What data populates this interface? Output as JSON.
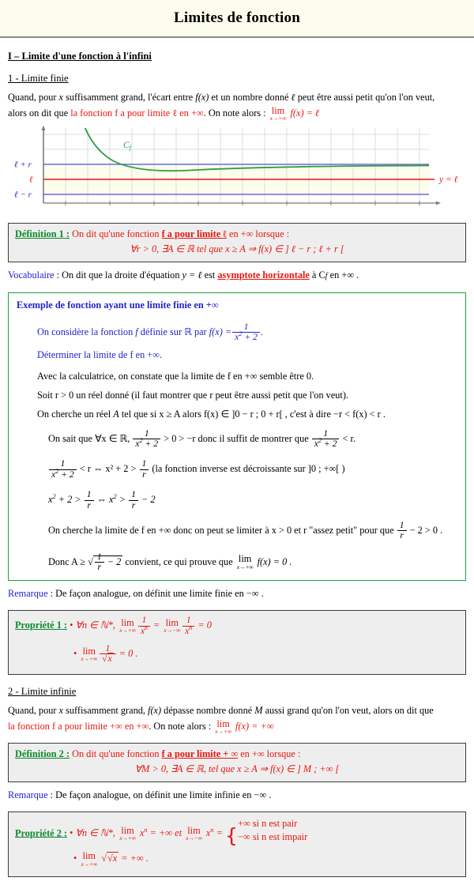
{
  "header": {
    "title": "Limites de fonction"
  },
  "section1": {
    "heading": "I – Limite d'une fonction à l'infini",
    "sub1": "1 - Limite finie",
    "intro_a": "Quand, pour ",
    "intro_x": "x",
    "intro_b": " suffisamment grand, l'écart entre ",
    "intro_fx": "f(x)",
    "intro_c": " et un nombre donné ",
    "intro_l": "ℓ",
    "intro_d": " peut être aussi petit qu'on l'on veut,",
    "intro_e": "alors on dit que ",
    "intro_red": "la fonction f a pour limite ℓ en +∞",
    "intro_f": ". On note alors : ",
    "lim_label": "lim",
    "lim_sub": "x→+∞",
    "lim_body": "f(x) = ℓ"
  },
  "graph": {
    "label_curve": "Cf",
    "label_upper": "ℓ + r",
    "label_mid": "ℓ",
    "label_lower": "ℓ − r",
    "label_asymptote": "y = ℓ",
    "colors": {
      "curve": "#2e9e3e",
      "band": "#6a6ae0",
      "mid": "#e8150f",
      "axis": "#7b7b7b",
      "grid": "#d8d8d8",
      "fill": "#fdfdee"
    }
  },
  "definition1": {
    "label": "Définition 1 :",
    "text_a": "On dit qu'une fonction ",
    "text_bold": "f a pour limite ℓ",
    "text_b": " en +∞ lorsque :",
    "formula": "∀r > 0,  ∃A ∈ ℝ tel que  x ≥ A  ⇒  f(x) ∈ ] ℓ − r ; ℓ + r ["
  },
  "vocabulaire": {
    "label": "Vocabulaire",
    "text_a": " : On dit que la droite d'équation  ",
    "eq": "y = ℓ",
    "text_b": "  est ",
    "underlined": "asymptote horizontale",
    "text_c": " à C",
    "sub": "f",
    "text_d": " en +∞ ."
  },
  "example": {
    "title": "Exemple de fonction ayant une limite finie en +∞",
    "line1_a": "On considère la fonction ",
    "line1_f": "f",
    "line1_b": " définie sur ",
    "line1_R": "ℝ",
    "line1_c": " par ",
    "line1_fx": "f(x) =",
    "frac_num": "1",
    "frac_den": "x² + 2",
    "line1_end": ".",
    "line2": "Déterminer la limite de  f  en +∞.",
    "line3": "Avec la calculatrice, on constate que la limite de  f  en +∞ semble être 0.",
    "line4": "Soit  r > 0  un réel donné (il faut montrer que r peut être aussi petit que l'on veut).",
    "line5_a": "On cherche un réel ",
    "line5_A": "A",
    "line5_b": " tel que si  x ≥ A  alors  f(x) ∈ ]0 − r ; 0 + r[ , c'est à dire  −r < f(x) < r .",
    "line6_a": "On sait que  ∀x ∈ ℝ, ",
    "line6_b": " > 0 > −r  donc il suffit de montrer que ",
    "line6_c": " < r.",
    "line7_a": " < r ⇔ x² + 2 > ",
    "line7_frac2": "1 / r",
    "line7_b": "  (la fonction inverse est décroissante sur ]0 ; +∞[ )",
    "line8": "x² + 2 > 1/r ⇔ x² > 1/r − 2",
    "line9_a": "On cherche la limite de  f  en +∞ donc on peut se limiter à  x > 0  et r \"assez petit\" pour que ",
    "line9_b": " − 2 > 0 .",
    "line10_a": "Donc  A ≥ ",
    "line10_sqrt_num": "1",
    "line10_sqrt_den": "r",
    "line10_minus": " − 2",
    "line10_b": "  convient, ce qui prouve que  ",
    "line10_lim": "lim",
    "line10_lim_sub": "x→+∞",
    "line10_c": "f(x) = 0 ."
  },
  "remarque1": {
    "label": "Remarque",
    "text": " : De façon analogue, on définit une limite finie en −∞ ."
  },
  "propriete1": {
    "label": "Propriété 1 :",
    "bullet1_a": "∀n ∈ ℕ*, ",
    "bullet1_lim1": "lim",
    "bullet1_lim1_sub": "x→+∞",
    "bullet1_f1": "1 / xⁿ",
    "bullet1_eq": " = ",
    "bullet1_lim2": "lim",
    "bullet1_lim2_sub": "x→−∞",
    "bullet1_f2": "1 / xⁿ",
    "bullet1_end": " = 0",
    "bullet2_lim": "lim",
    "bullet2_lim_sub": "x→+∞",
    "bullet2_frac": "1 / √x",
    "bullet2_end": " = 0 ."
  },
  "section2": {
    "sub2": "2 - Limite infinie",
    "intro_a": "Quand, pour ",
    "intro_x": "x",
    "intro_b": " suffisamment grand, ",
    "intro_fx": "f(x)",
    "intro_c": " dépasse nombre donné ",
    "intro_M": "M",
    "intro_d": " aussi grand qu'on l'on veut, alors on dit que",
    "intro_red": "la fonction f a pour limite +∞ en +∞",
    "intro_e": ". On note alors : ",
    "lim_label": "lim",
    "lim_sub": "x→+∞",
    "lim_body": "f(x) = +∞"
  },
  "definition2": {
    "label": "Définition 2 :",
    "text_a": "On dit qu'une fonction ",
    "text_bold": "f a pour limite + ∞",
    "text_b": " en +∞ lorsque :",
    "formula": "∀M > 0,  ∃A ∈ ℝ, tel que  x ≥ A  ⇒  f(x) ∈ ] M ; +∞ ["
  },
  "remarque2": {
    "label": "Remarque",
    "text": " : De façon analogue, on définit une limite infinie en −∞ ."
  },
  "propriete2": {
    "label": "Propriété 2 :",
    "bullet1_a": "∀n ∈ ℕ*, ",
    "bullet1_lim1": "lim",
    "bullet1_lim1_sub": "x→+∞",
    "bullet1_x1": "xⁿ",
    "bullet1_eq1": " = +∞",
    "bullet1_et": "  et  ",
    "bullet1_lim2": "lim",
    "bullet1_lim2_sub": "x→−∞",
    "bullet1_x2": "xⁿ",
    "bullet1_eq2": " = ",
    "case1": "+∞ si n est pair",
    "case2": "−∞ si n est impair",
    "bullet2_lim": "lim",
    "bullet2_lim_sub": "x→+∞",
    "bullet2_body": "√x",
    "bullet2_end": " = +∞ ."
  },
  "chart_data": {
    "type": "line",
    "title": "",
    "xlabel": "",
    "ylabel": "",
    "xlim": [
      0,
      18
    ],
    "ylim": [
      0,
      7
    ],
    "grid": true,
    "series": [
      {
        "name": "Cf",
        "color": "#2e9e3e",
        "x": [
          1.6,
          2.0,
          2.5,
          3.0,
          3.5,
          4.0,
          5.0,
          6.0,
          7.0,
          8.0,
          9.0,
          10.0,
          12.0,
          14.0,
          16.0,
          18.0
        ],
        "y": [
          7.0,
          6.0,
          5.2,
          4.75,
          4.45,
          4.25,
          4.0,
          3.85,
          3.76,
          3.7,
          3.65,
          3.6,
          3.53,
          3.48,
          3.45,
          3.42
        ]
      },
      {
        "name": "ℓ + r",
        "color": "#6a6ae0",
        "constant": 4.0
      },
      {
        "name": "ℓ",
        "color": "#e8150f",
        "constant": 3.0
      },
      {
        "name": "ℓ − r",
        "color": "#6a6ae0",
        "constant": 2.0
      }
    ],
    "annotations": [
      {
        "text": "Cf",
        "x": 3.4,
        "y": 5.1,
        "color": "#2e9e3e"
      },
      {
        "text": "ℓ + r",
        "x": -1.4,
        "y": 4.0,
        "color": "#2222cc"
      },
      {
        "text": "ℓ",
        "x": -0.7,
        "y": 3.0,
        "color": "#e8150f"
      },
      {
        "text": "ℓ − r",
        "x": -1.4,
        "y": 2.0,
        "color": "#2222cc"
      },
      {
        "text": "y = ℓ",
        "x": 18.6,
        "y": 2.85,
        "color": "#e8150f"
      }
    ]
  }
}
